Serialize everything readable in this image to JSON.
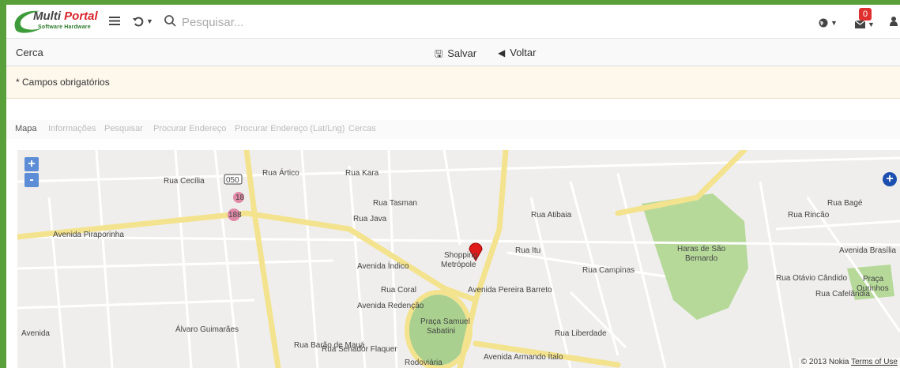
{
  "brand": {
    "name_part1": "Multi ",
    "name_part2": "Portal",
    "tagline": "Software Hardware"
  },
  "header": {
    "search_placeholder": "Pesquisar...",
    "notification_count": "0",
    "icons": [
      "menu-icon",
      "history-icon",
      "search-icon",
      "globe-icon",
      "envelope-icon",
      "user-icon"
    ]
  },
  "toolbar": {
    "title": "Cerca",
    "save_label": "Salvar",
    "back_label": "Voltar"
  },
  "notice": {
    "text": "* Campos obrigatórios"
  },
  "tabs": [
    {
      "label": "Mapa"
    },
    {
      "label": "Informações"
    },
    {
      "label": "Pesquisar"
    },
    {
      "label": "Procurar Endereço"
    },
    {
      "label": "Procurar Endereço (Lat/Lng)"
    },
    {
      "label": "Cercas"
    }
  ],
  "map": {
    "zoom_in": "+",
    "zoom_out": "-",
    "copyright": "© 2013 Nokia",
    "terms": "Terms of Use",
    "labels": {
      "l1": "Rua Cecília",
      "l2": "050",
      "l3": "Rua Ártico",
      "l4": "Rua Kara",
      "l5": "18",
      "l6": "188",
      "l7": "Avenida Piraporinha",
      "l8": "Rua Java",
      "l9": "Rua Tasman",
      "l10": "Avenida Pereira Barreto",
      "l11": "Rua Itu",
      "l12": "Rua Atibaia",
      "l13": "Shopping",
      "l14": "Metrópole",
      "l15": "Rua Campinas",
      "l16": "Haras de São",
      "l17": "Bernardo",
      "l18": "Rua Bagé",
      "l19": "Rua Rincão",
      "l20": "Avenida Brasília",
      "l21": "Praça",
      "l22": "Ourinhos",
      "l23": "Avenida Índico",
      "l24": "Rua Coral",
      "l25": "Avenida Redenção",
      "l26": "Praça Samuel",
      "l27": "Sabatini",
      "l28": "Avenida Armando Ítalo",
      "l29": "Rodoviária",
      "l30": "Rua Liberdade",
      "l31": "Rua Otávio Cândido",
      "l32": "Rua Cafelândia",
      "l33": "Rua Barão de Mauá",
      "l34": "Rua Senador Flaquer",
      "l35": "Avenida",
      "l36": "Álvaro Guimarães"
    }
  }
}
